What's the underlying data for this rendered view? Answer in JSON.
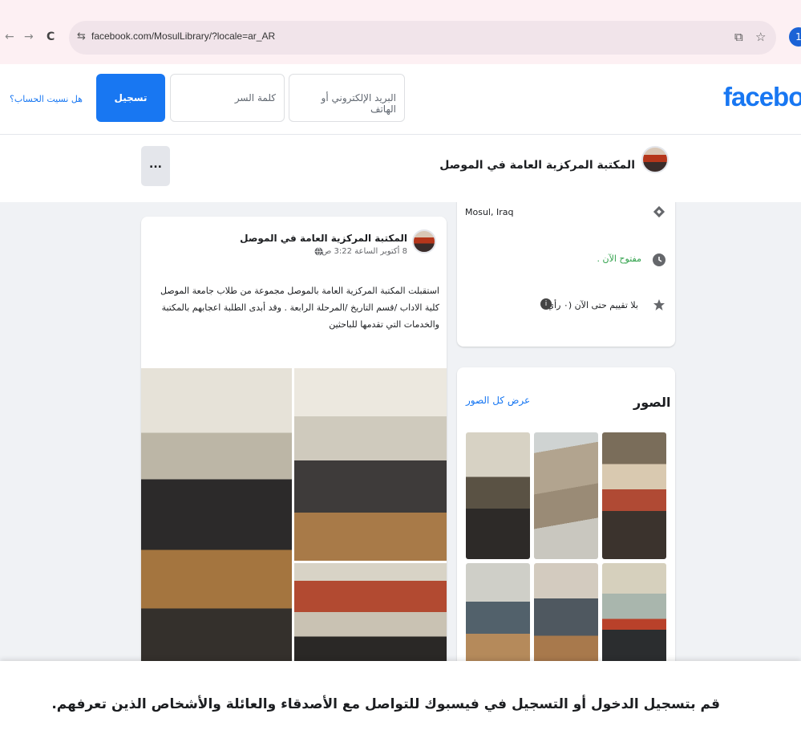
{
  "browser": {
    "back_icon": "←",
    "forward_icon": "→",
    "reload_icon": "C",
    "site_info_icon": "⇆",
    "url": "facebook.com/MosulLibrary/?locale=ar_AR",
    "screen_share_icon": "⧉",
    "bookmark_icon": "☆",
    "profile_initial": "1"
  },
  "header": {
    "logo": "facebook",
    "email_placeholder": "البريد الإلكتروني أو الهاتف",
    "password_placeholder": "كلمة السر",
    "login_label": "تسجيل الدخول",
    "forgot_label": "هل نسيت الحساب؟"
  },
  "page": {
    "name": "المكتبة المركزية العامة في الموصل",
    "more_label": "..."
  },
  "intro": {
    "location": "Mosul, Iraq",
    "open_status": "مفتوح الآن .",
    "rating": "بلا تقييم حتى الآن (٠ رأي)",
    "rating_info": "i"
  },
  "photos": {
    "title": "الصور",
    "see_all": "عرض كل الصور"
  },
  "post": {
    "author": "المكتبة المركزية العامة في الموصل",
    "date": "8 أكتوبر الساعة 3:22 ص",
    "privacy_icon": "globe",
    "body": "استقبلت المكتبة المركزية العامة بالموصل مجموعة من طلاب جامعة الموصل كلية الاداب /قسم التاريخ /المرحلة الرابعة . وقد أبدى الطلبة اعجابهم بالمكتبة والخدمات التي تقدمها للباحثين"
  },
  "banner": {
    "text": "قم بتسجيل الدخول أو التسجيل في فيسبوك للتواصل مع الأصدقاء والعائلة والأشخاص الذين تعرفهم."
  },
  "colors": {
    "brand": "#1877f2",
    "open_status": "#31a24c",
    "background": "#f0f2f5"
  }
}
